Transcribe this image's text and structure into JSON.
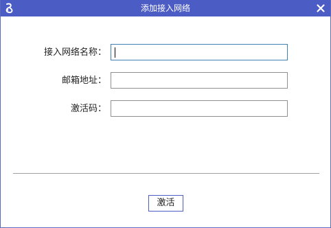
{
  "window": {
    "title": "添加接入网络",
    "logo_icon": "app-logo-icon",
    "close_icon": "close-icon",
    "titlebar_color": "#4b5cc4"
  },
  "form": {
    "network_name_label": "接入网络名称：",
    "network_name_value": "",
    "email_label": "邮箱地址：",
    "email_value": "",
    "activation_code_label": "激活码：",
    "activation_code_value": ""
  },
  "actions": {
    "activate_label": "激活"
  }
}
